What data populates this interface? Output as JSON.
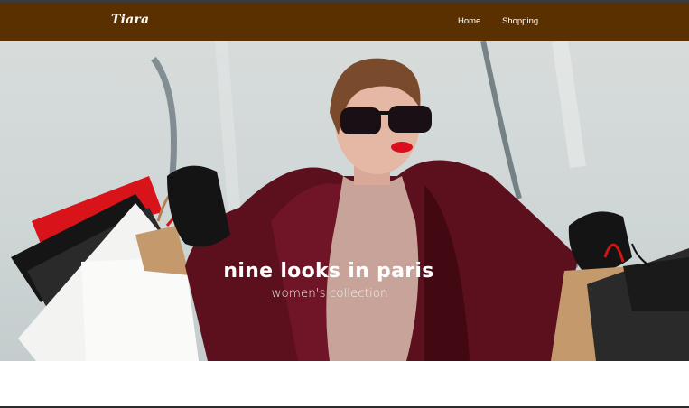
{
  "navbar": {
    "brand": "Tiara",
    "links": [
      {
        "label": "Home"
      },
      {
        "label": "Shopping"
      }
    ],
    "background": "#5a3000"
  },
  "hero": {
    "title": "nine looks in paris",
    "subtitle": "women's collection",
    "image_subject": "woman in sunglasses and burgundy coat holding shopping bags"
  }
}
